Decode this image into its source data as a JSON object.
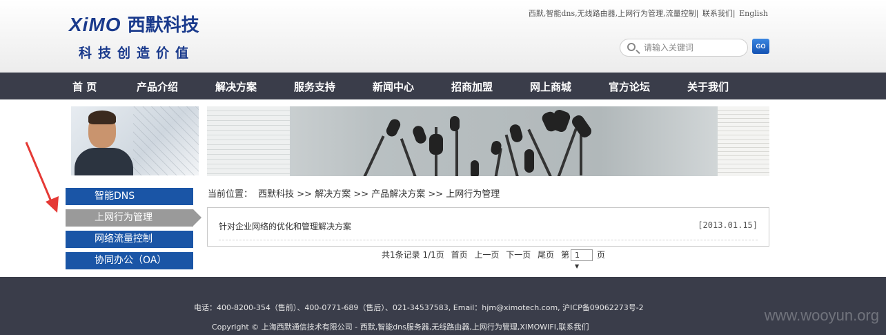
{
  "header": {
    "brand_en": "XiMO",
    "brand_cn": "西默科技",
    "slogan": "科技创造价值",
    "top_links": [
      "西默,智能dns,无线路由器,上网行为管理,流量控制|",
      "联系我们|",
      "English"
    ],
    "search_placeholder": "请输入关键词",
    "go_label": "GO"
  },
  "nav": {
    "items": [
      "首 页",
      "产品介绍",
      "解决方案",
      "服务支持",
      "新闻中心",
      "招商加盟",
      "网上商城",
      "官方论坛",
      "关于我们"
    ]
  },
  "sidebar": {
    "items": [
      "智能DNS",
      "上网行为管理",
      "网络流量控制",
      "协同办公（OA）"
    ],
    "active_index": 1
  },
  "breadcrumb": {
    "label": "当前位置：",
    "path": "西默科技 >> 解决方案 >> 产品解决方案 >> 上网行为管理"
  },
  "list": {
    "items": [
      {
        "title": "针对企业网络的优化和管理解决方案",
        "date": "[2013.01.15]"
      }
    ]
  },
  "pager": {
    "summary": "共1条记录 1/1页",
    "first": "首页",
    "prev": "上一页",
    "next": "下一页",
    "last": "尾页",
    "page_prefix": "第",
    "page_value": "1",
    "page_suffix": "页"
  },
  "footer": {
    "line1": "电话：400-8200-354（售前）、400-0771-689（售后）、021-34537583, Email：hjm@ximotech.com, 沪ICP备09062273号-2",
    "line2": "Copyright © 上海西默通信技术有限公司 - 西默,智能dns服务器,无线路由器,上网行为管理,XIMOWIFI,联系我们"
  },
  "watermark": "www.wooyun.org",
  "colors": {
    "brand_blue": "#1a3a8c",
    "nav_bg": "#3a3d4a",
    "sidebar_blue": "#1a55a6",
    "sidebar_active": "#9a9a9a",
    "arrow_red": "#e53935"
  }
}
